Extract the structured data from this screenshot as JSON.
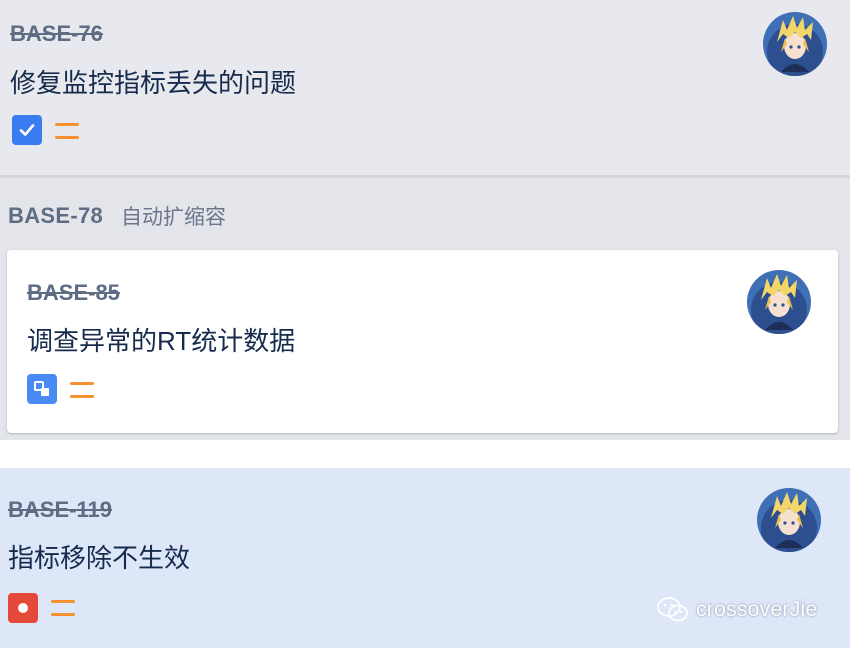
{
  "cards": [
    {
      "key": "BASE-76",
      "summary": "修复监控指标丢失的问题",
      "type_icon": "checkbox-icon",
      "priority": "medium-priority-icon",
      "status": "done"
    },
    {
      "key": "BASE-85",
      "summary": "调查异常的RT统计数据",
      "type_icon": "subtask-icon",
      "priority": "medium-priority-icon",
      "status": "done"
    },
    {
      "key": "BASE-119",
      "summary": "指标移除不生效",
      "type_icon": "bug-icon",
      "priority": "medium-priority-icon",
      "status": "done"
    }
  ],
  "epic": {
    "key": "BASE-78",
    "name": "自动扩缩容"
  },
  "watermark": {
    "text": "crossoverJie"
  },
  "colors": {
    "story_icon": "#3b7cf0",
    "subtask_icon": "#4a8af4",
    "bug_icon": "#e5493a",
    "priority": "#f79232",
    "selected_card": "#dde7f8"
  }
}
